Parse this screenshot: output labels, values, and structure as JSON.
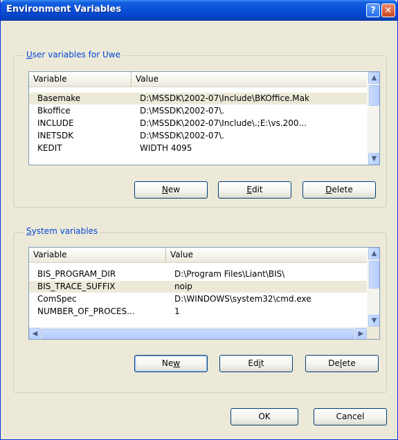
{
  "window": {
    "title": "Environment Variables"
  },
  "titlebar_buttons": {
    "help": "?",
    "close": "✕"
  },
  "user_group": {
    "label_prefix": "",
    "label_accel": "U",
    "label_rest": "ser variables for Uwe",
    "columns": [
      "Variable",
      "Value"
    ],
    "rows": [
      {
        "variable": "Basemake",
        "value": "D:\\MSSDK\\2002-07\\Include\\BKOffice.Mak",
        "selected": true
      },
      {
        "variable": "Bkoffice",
        "value": "D:\\MSSDK\\2002-07\\.",
        "selected": false
      },
      {
        "variable": "INCLUDE",
        "value": "D:\\MSSDK\\2002-07\\Include\\.;E:\\vs.200...",
        "selected": false
      },
      {
        "variable": "INETSDK",
        "value": "D:\\MSSDK\\2002-07\\.",
        "selected": false
      },
      {
        "variable": "KEDIT",
        "value": "WIDTH 4095",
        "selected": false
      }
    ],
    "buttons": {
      "new_accel": "N",
      "new_rest": "ew",
      "edit_pre": "",
      "edit_accel": "E",
      "edit_rest": "dit",
      "delete_accel": "D",
      "delete_rest": "elete"
    }
  },
  "system_group": {
    "label_accel": "S",
    "label_rest": "ystem variables",
    "columns": [
      "Variable",
      "Value"
    ],
    "rows": [
      {
        "variable": "BIS_PROGRAM_DIR",
        "value": "D:\\Program Files\\Liant\\BIS\\",
        "selected": false
      },
      {
        "variable": "BIS_TRACE_SUFFIX",
        "value": "noip",
        "selected": true
      },
      {
        "variable": "ComSpec",
        "value": "D:\\WINDOWS\\system32\\cmd.exe",
        "selected": false
      },
      {
        "variable": "NUMBER_OF_PROCES...",
        "value": "1",
        "selected": false
      }
    ],
    "buttons": {
      "new_pre": "Ne",
      "new_accel": "w",
      "new_rest": "",
      "edit_pre": "Ed",
      "edit_accel": "i",
      "edit_rest": "t",
      "delete_pre": "De",
      "delete_accel": "l",
      "delete_rest": "ete"
    }
  },
  "dialog_buttons": {
    "ok": "OK",
    "cancel": "Cancel"
  },
  "scroll_glyphs": {
    "up": "▲",
    "down": "▼",
    "left": "◀",
    "right": "▶"
  }
}
